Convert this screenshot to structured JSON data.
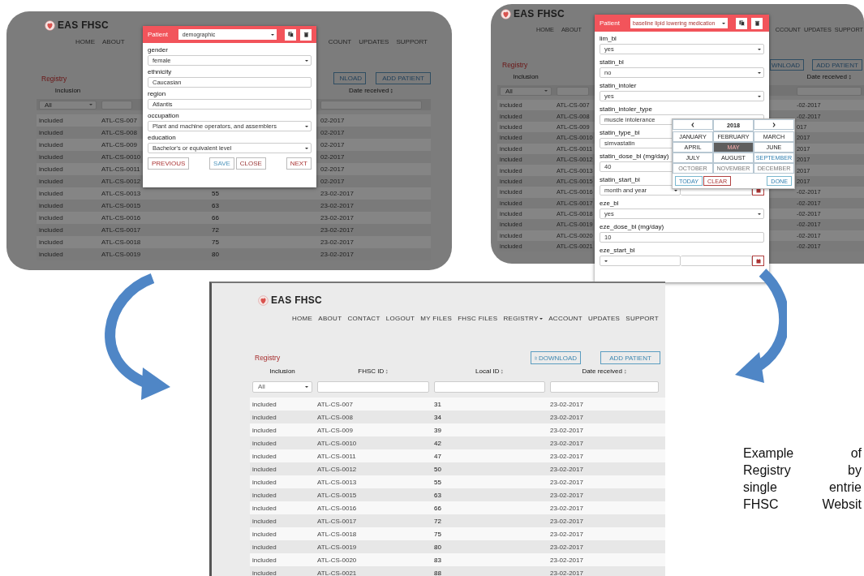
{
  "screens": [
    {
      "kind": "dimmed",
      "logo": "EAS FHSC",
      "nav_left": [
        {
          "label": "HOME",
          "dropdown": false
        },
        {
          "label": "ABOUT",
          "dropdown": false
        }
      ],
      "nav_right": [
        {
          "label": "COUNT",
          "dropdown": false
        },
        {
          "label": "UPDATES",
          "dropdown": false
        },
        {
          "label": "SUPPORT",
          "dropdown": false
        }
      ],
      "title": "Registry",
      "buttons": [
        {
          "label": "NLOAD",
          "kind": "plain"
        },
        {
          "label": "ADD PATIENT",
          "kind": "plain"
        }
      ],
      "columns": [
        {
          "label": "Inclusion",
          "sortable": false
        },
        {
          "label": "Date received",
          "sortable": true
        }
      ],
      "filter": "All",
      "rows": [
        {
          "inclusion": "included",
          "fhsc_id": "ATL-CS-007",
          "date": "02-2017"
        },
        {
          "inclusion": "included",
          "fhsc_id": "ATL-CS-008",
          "date": "02-2017"
        },
        {
          "inclusion": "included",
          "fhsc_id": "ATL-CS-009",
          "date": "02-2017"
        },
        {
          "inclusion": "included",
          "fhsc_id": "ATL-CS-0010",
          "date": "02-2017"
        },
        {
          "inclusion": "included",
          "fhsc_id": "ATL-CS-0011",
          "date": "02-2017"
        },
        {
          "inclusion": "included",
          "fhsc_id": "ATL-CS-0012",
          "date": "02-2017"
        },
        {
          "inclusion": "included",
          "fhsc_id": "ATL-CS-0013",
          "local_id": "55",
          "date": "23-02-2017"
        },
        {
          "inclusion": "included",
          "fhsc_id": "ATL-CS-0015",
          "local_id": "63",
          "date": "23-02-2017"
        },
        {
          "inclusion": "included",
          "fhsc_id": "ATL-CS-0016",
          "local_id": "66",
          "date": "23-02-2017"
        },
        {
          "inclusion": "included",
          "fhsc_id": "ATL-CS-0017",
          "local_id": "72",
          "date": "23-02-2017"
        },
        {
          "inclusion": "included",
          "fhsc_id": "ATL-CS-0018",
          "local_id": "75",
          "date": "23-02-2017"
        },
        {
          "inclusion": "included",
          "fhsc_id": "ATL-CS-0019",
          "local_id": "80",
          "date": "23-02-2017"
        }
      ],
      "modal": {
        "label": "Patient",
        "section": "demographic",
        "fields": [
          {
            "kind": "select",
            "label": "gender",
            "value": "female"
          },
          {
            "kind": "input",
            "label": "ethnicity",
            "value": "Caucasian"
          },
          {
            "kind": "input",
            "label": "region",
            "value": "Atlantis"
          },
          {
            "kind": "select",
            "label": "occupation",
            "value": "Plant and machine operators, and assemblers"
          },
          {
            "kind": "select",
            "label": "education",
            "value": "Bachelor's or equivalent level"
          }
        ],
        "actions": [
          {
            "label": "PREVIOUS",
            "kind": "previous"
          },
          {
            "label": "SAVE",
            "kind": "save"
          },
          {
            "label": "CLOSE",
            "kind": "close"
          },
          {
            "label": "NEXT",
            "kind": "next"
          }
        ]
      }
    },
    {
      "kind": "dimmed",
      "logo": "EAS FHSC",
      "nav_left": [
        {
          "label": "HOME",
          "dropdown": false
        },
        {
          "label": "ABOUT",
          "dropdown": false
        }
      ],
      "nav_right": [
        {
          "label": "CCOUNT",
          "dropdown": false
        },
        {
          "label": "UPDATES",
          "dropdown": false
        },
        {
          "label": "SUPPORT",
          "dropdown": false
        }
      ],
      "title": "Registry",
      "buttons": [
        {
          "label": "WNLOAD",
          "kind": "plain"
        },
        {
          "label": "ADD PATIENT",
          "kind": "plain"
        }
      ],
      "columns": [
        {
          "label": "Inclusion",
          "sortable": false
        },
        {
          "label": "Date received",
          "sortable": true
        }
      ],
      "filter": "All",
      "rows": [
        {
          "inclusion": "included",
          "fhsc_id": "ATL-CS-007",
          "date": "-02-2017"
        },
        {
          "inclusion": "included",
          "fhsc_id": "ATL-CS-008",
          "date": "-02-2017"
        },
        {
          "inclusion": "included",
          "fhsc_id": "ATL-CS-009",
          "date": "017"
        },
        {
          "inclusion": "included",
          "fhsc_id": "ATL-CS-0010",
          "date": "2017"
        },
        {
          "inclusion": "included",
          "fhsc_id": "ATL-CS-0011",
          "date": "2017"
        },
        {
          "inclusion": "included",
          "fhsc_id": "ATL-CS-0012",
          "date": "2017"
        },
        {
          "inclusion": "included",
          "fhsc_id": "ATL-CS-0013",
          "date": "2017"
        },
        {
          "inclusion": "included",
          "fhsc_id": "ATL-CS-0015",
          "date": "2017"
        },
        {
          "inclusion": "included",
          "fhsc_id": "ATL-CS-0016",
          "date": "-02-2017"
        },
        {
          "inclusion": "included",
          "fhsc_id": "ATL-CS-0017",
          "date": "-02-2017"
        },
        {
          "inclusion": "included",
          "fhsc_id": "ATL-CS-0018",
          "date": "-02-2017"
        },
        {
          "inclusion": "included",
          "fhsc_id": "ATL-CS-0019",
          "date": "-02-2017"
        },
        {
          "inclusion": "included",
          "fhsc_id": "ATL-CS-0020",
          "date": "-02-2017"
        },
        {
          "inclusion": "included",
          "fhsc_id": "ATL-CS-0021",
          "date": "-02-2017"
        }
      ],
      "modal": {
        "label": "Patient",
        "section": "baseline lipid lowering medication",
        "fields": [
          {
            "kind": "select",
            "label": "lim_bl",
            "value": "yes"
          },
          {
            "kind": "select",
            "label": "statin_bl",
            "value": "no"
          },
          {
            "kind": "select",
            "label": "statin_intoler",
            "value": "yes"
          },
          {
            "kind": "input",
            "label": "statin_intoler_type",
            "value": "muscle intolerance"
          },
          {
            "kind": "input",
            "label": "statin_type_bl",
            "value": "simvastatin"
          },
          {
            "kind": "input",
            "label": "statin_dose_bl (mg/day)",
            "value": "40"
          },
          {
            "kind": "date",
            "label": "statin_start_bl",
            "value": "month and year"
          },
          {
            "kind": "select",
            "label": "eze_bl",
            "value": "yes"
          },
          {
            "kind": "input",
            "label": "eze_dose_bl (mg/day)",
            "value": "10"
          },
          {
            "kind": "date",
            "label": "eze_start_bl"
          }
        ],
        "calendar": {
          "year": "2018",
          "months": [
            {
              "label": "JANUARY",
              "selected": false,
              "current": false,
              "disabled": false
            },
            {
              "label": "FEBRUARY",
              "selected": false,
              "current": false,
              "disabled": false
            },
            {
              "label": "MARCH",
              "selected": false,
              "current": false,
              "disabled": false
            },
            {
              "label": "APRIL",
              "selected": false,
              "current": false,
              "disabled": false
            },
            {
              "label": "MAY",
              "selected": true,
              "current": false,
              "disabled": false
            },
            {
              "label": "JUNE",
              "selected": false,
              "current": false,
              "disabled": false
            },
            {
              "label": "JULY",
              "selected": false,
              "current": false,
              "disabled": false
            },
            {
              "label": "AUGUST",
              "selected": false,
              "current": false,
              "disabled": false
            },
            {
              "label": "SEPTEMBER",
              "selected": false,
              "current": true,
              "disabled": false
            },
            {
              "label": "OCTOBER",
              "selected": false,
              "current": false,
              "disabled": true
            },
            {
              "label": "NOVEMBER",
              "selected": false,
              "current": false,
              "disabled": true
            },
            {
              "label": "DECEMBER",
              "selected": false,
              "current": false,
              "disabled": true
            }
          ],
          "actions": [
            {
              "label": "TODAY",
              "kind": "today"
            },
            {
              "label": "CLEAR",
              "kind": "clear"
            },
            {
              "label": "DONE",
              "kind": "done"
            }
          ]
        }
      }
    },
    {
      "kind": "plain",
      "logo": "EAS FHSC",
      "nav_left": [
        {
          "label": "HOME",
          "dropdown": false
        },
        {
          "label": "ABOUT",
          "dropdown": false
        },
        {
          "label": "CONTACT",
          "dropdown": false
        },
        {
          "label": "LOGOUT",
          "dropdown": false
        },
        {
          "label": "MY FILES",
          "dropdown": false
        },
        {
          "label": "FHSC FILES",
          "dropdown": false
        },
        {
          "label": "REGISTRY",
          "dropdown": true
        },
        {
          "label": "ACCOUNT",
          "dropdown": false
        },
        {
          "label": "UPDATES",
          "dropdown": false
        },
        {
          "label": "SUPPORT",
          "dropdown": false
        }
      ],
      "title": "Registry",
      "buttons": [
        {
          "label": "DOWNLOAD",
          "kind": "download"
        },
        {
          "label": "ADD PATIENT",
          "kind": "plain"
        }
      ],
      "columns": [
        {
          "label": "Inclusion",
          "sortable": false
        },
        {
          "label": "FHSC ID",
          "sortable": true
        },
        {
          "label": "Local ID",
          "sortable": true
        },
        {
          "label": "Date received",
          "sortable": true
        }
      ],
      "filter": "All",
      "rows": [
        {
          "inclusion": "included",
          "fhsc_id": "ATL-CS-007",
          "local_id": "31",
          "date": "23-02-2017"
        },
        {
          "inclusion": "included",
          "fhsc_id": "ATL-CS-008",
          "local_id": "34",
          "date": "23-02-2017"
        },
        {
          "inclusion": "included",
          "fhsc_id": "ATL-CS-009",
          "local_id": "39",
          "date": "23-02-2017"
        },
        {
          "inclusion": "included",
          "fhsc_id": "ATL-CS-0010",
          "local_id": "42",
          "date": "23-02-2017"
        },
        {
          "inclusion": "included",
          "fhsc_id": "ATL-CS-0011",
          "local_id": "47",
          "date": "23-02-2017"
        },
        {
          "inclusion": "included",
          "fhsc_id": "ATL-CS-0012",
          "local_id": "50",
          "date": "23-02-2017"
        },
        {
          "inclusion": "included",
          "fhsc_id": "ATL-CS-0013",
          "local_id": "55",
          "date": "23-02-2017"
        },
        {
          "inclusion": "included",
          "fhsc_id": "ATL-CS-0015",
          "local_id": "63",
          "date": "23-02-2017"
        },
        {
          "inclusion": "included",
          "fhsc_id": "ATL-CS-0016",
          "local_id": "66",
          "date": "23-02-2017"
        },
        {
          "inclusion": "included",
          "fhsc_id": "ATL-CS-0017",
          "local_id": "72",
          "date": "23-02-2017"
        },
        {
          "inclusion": "included",
          "fhsc_id": "ATL-CS-0018",
          "local_id": "75",
          "date": "23-02-2017"
        },
        {
          "inclusion": "included",
          "fhsc_id": "ATL-CS-0019",
          "local_id": "80",
          "date": "23-02-2017"
        },
        {
          "inclusion": "included",
          "fhsc_id": "ATL-CS-0020",
          "local_id": "83",
          "date": "23-02-2017"
        },
        {
          "inclusion": "included",
          "fhsc_id": "ATL-CS-0021",
          "local_id": "88",
          "date": "23-02-2017"
        }
      ]
    }
  ],
  "caption": [
    "Example of",
    "Registry by",
    "single entrie",
    "FHSC Websit"
  ]
}
